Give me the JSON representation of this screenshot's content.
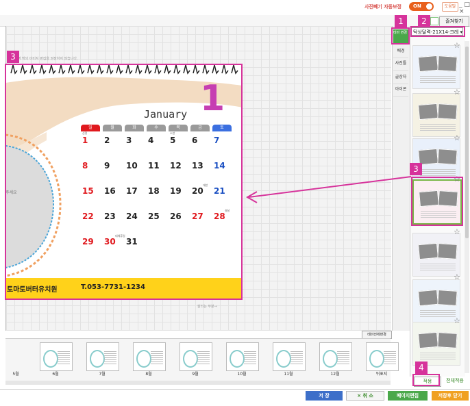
{
  "topbar": {
    "autosave_text": "사진빼기 자동보정",
    "toggle_label": "ON",
    "help_label": "도움말",
    "window_icons": "_ □ ×"
  },
  "toolbar": {
    "favorites_label": "즐겨찾기"
  },
  "canvas": {
    "note": "편집영역 밖의 이미지 편집을 권장하지 않습니다.",
    "cut_note": "잘리는 부분→"
  },
  "calendar": {
    "month_name": "January",
    "month_number": "1",
    "weekdays": [
      "일",
      "월",
      "화",
      "수",
      "목",
      "금",
      "토"
    ],
    "weekday_colors": [
      "#e0191e",
      "#9a9a9a",
      "#9a9a9a",
      "#9a9a9a",
      "#9a9a9a",
      "#9a9a9a",
      "#3b6fe0"
    ],
    "rows": [
      [
        {
          "d": "1",
          "c": "red",
          "n": "신정"
        },
        {
          "d": "2"
        },
        {
          "d": "3"
        },
        {
          "d": "4"
        },
        {
          "d": "5",
          "n": "소한"
        },
        {
          "d": "6"
        },
        {
          "d": "7",
          "c": "blue"
        }
      ],
      [
        {
          "d": "8",
          "c": "red"
        },
        {
          "d": "9"
        },
        {
          "d": "10"
        },
        {
          "d": "11"
        },
        {
          "d": "12"
        },
        {
          "d": "13"
        },
        {
          "d": "14",
          "c": "blue"
        }
      ],
      [
        {
          "d": "15",
          "c": "red"
        },
        {
          "d": "16"
        },
        {
          "d": "17"
        },
        {
          "d": "18"
        },
        {
          "d": "19"
        },
        {
          "d": "20",
          "n": "대한"
        },
        {
          "d": "21",
          "c": "blue"
        }
      ],
      [
        {
          "d": "22",
          "c": "red"
        },
        {
          "d": "23"
        },
        {
          "d": "24"
        },
        {
          "d": "25"
        },
        {
          "d": "26"
        },
        {
          "d": "27",
          "c": "red"
        },
        {
          "d": "28",
          "c": "red",
          "n": "설날"
        }
      ],
      [
        {
          "d": "29",
          "c": "red"
        },
        {
          "d": "30",
          "c": "red",
          "n": "대체휴일"
        },
        {
          "d": "31"
        }
      ]
    ],
    "school_name": "토마토버터유치원",
    "phone": "T.053-7731-1234",
    "photo_hint": "주세요"
  },
  "side_tools": {
    "theme_change": "테마 변경",
    "items": [
      "배경",
      "사진틀",
      "글상자",
      "아이콘"
    ]
  },
  "theme_panel": {
    "selected_theme": "탁상달력-21X14-크레",
    "apply_label": "적용",
    "apply_all_label": "전체적용",
    "theme_all_change": "테마전체변경"
  },
  "filmstrip": {
    "labels": [
      "5월",
      "6월",
      "7월",
      "8월",
      "9월",
      "10월",
      "11월",
      "12월",
      "뒤표지"
    ]
  },
  "bottom": {
    "save": "저 장",
    "cancel": "× 취 소",
    "page_edit": "페이지편집",
    "save_close": "저장후 닫기"
  },
  "annotations": [
    "1",
    "2",
    "3",
    "3",
    "4"
  ],
  "colors": {
    "accent": "#d6339b",
    "toggle": "#e8601c",
    "yellow_bar": "#ffd21a",
    "save": "#3d6fc9",
    "page_edit": "#4aa84a",
    "save_close": "#f0a020"
  }
}
